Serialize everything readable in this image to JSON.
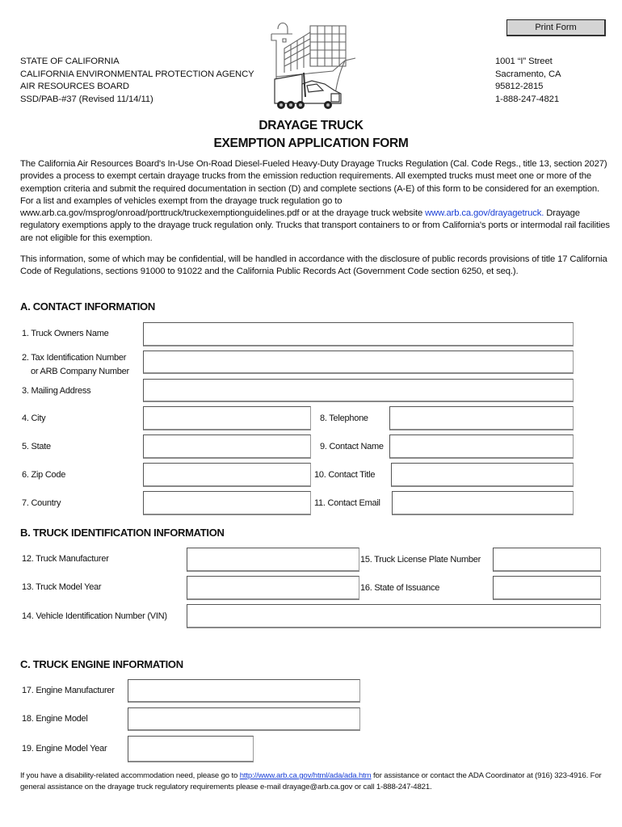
{
  "toolbar": {
    "print_label": "Print Form"
  },
  "header": {
    "left_lines": [
      "STATE OF CALIFORNIA",
      "CALIFORNIA ENVIRONMENTAL PROTECTION AGENCY",
      "AIR RESOURCES BOARD",
      "SSD/PAB-#37 (Revised 11/14/11)"
    ],
    "right_lines": [
      "1001 “I” Street",
      "Sacramento, CA",
      "95812-2815",
      "1-888-247-4821"
    ],
    "logo": "truck-and-ship-logo"
  },
  "title": {
    "line1": "DRAYAGE TRUCK",
    "line2": "EXEMPTION APPLICATION FORM"
  },
  "intro": {
    "para1_part1": "The California Air Resources Board's In-Use On-Road Diesel-Fueled Heavy-Duty Drayage Trucks Regulation (Cal. Code Regs., title 13, section 2027) provides a process to exempt certain drayage trucks from the emission reduction requirements.  All exempted trucks must meet one or more of the exemption criteria and submit the required documentation in section (D) and complete sections (A-E) of this form to be considered for an exemption.  For a list and examples of vehicles exempt from the drayage truck regulation go to www.arb.ca.gov/msprog/onroad/porttruck/truckexemptionguidelines.pdf or at the drayage truck website ",
    "para1_link": "www.arb.ca.gov/drayagetruck.",
    "para1_part2": " Drayage regulatory exemptions apply to the drayage truck regulation only.  Trucks that transport containers to or from California's ports or intermodal rail facilities are not eligible for this exemption.",
    "para2": "This information, some of which may be confidential, will be handled in accordance with the disclosure of public records provisions of title 17 California Code of Regulations, sections 91000 to 91022 and the California Public Records Act (Government Code section 6250, et seq.)."
  },
  "sections": {
    "a": {
      "title": "A.  CONTACT INFORMATION",
      "fields": {
        "f1": {
          "label": "1. Truck Owners Name",
          "value": ""
        },
        "f2": {
          "label": "2. Tax Identification Number",
          "label2": "or ARB Company Number",
          "value": ""
        },
        "f3": {
          "label": "3. Mailing Address",
          "value": ""
        },
        "f4": {
          "label": "4. City",
          "value": ""
        },
        "f5": {
          "label": "5. State",
          "value": ""
        },
        "f6": {
          "label": "6. Zip Code",
          "value": ""
        },
        "f7": {
          "label": "7. Country",
          "value": ""
        },
        "f8": {
          "label": "8. Telephone",
          "value": ""
        },
        "f9": {
          "label": "9. Contact Name",
          "value": ""
        },
        "f10": {
          "label": "10. Contact Title",
          "value": ""
        },
        "f11": {
          "label": "11. Contact Email",
          "value": ""
        }
      }
    },
    "b": {
      "title": "B.  TRUCK IDENTIFICATION INFORMATION",
      "fields": {
        "f12": {
          "label": "12. Truck Manufacturer",
          "value": ""
        },
        "f13": {
          "label": "13. Truck Model Year",
          "value": ""
        },
        "f14": {
          "label": "14. Vehicle Identification Number (VIN)",
          "value": ""
        },
        "f15": {
          "label": "15. Truck License Plate Number",
          "value": ""
        },
        "f16": {
          "label": "16. State of Issuance",
          "value": ""
        }
      }
    },
    "c": {
      "title": "C.  TRUCK ENGINE INFORMATION",
      "fields": {
        "f17": {
          "label": "17. Engine Manufacturer",
          "value": ""
        },
        "f18": {
          "label": "18. Engine Model",
          "value": ""
        },
        "f19": {
          "label": "19. Engine Model Year",
          "value": ""
        }
      }
    }
  },
  "footer": {
    "part1": "If you have a disability-related accommodation need, please go to ",
    "link": "http://www.arb.ca.gov/html/ada/ada.htm",
    "part2": " for assistance or contact the ADA Coordinator at (916) 323-4916.  For general assistance on the drayage truck regulatory requirements please e-mail drayage@arb.ca.gov or call 1-888-247-4821."
  },
  "colors": {
    "link": "#1a3fd6",
    "button_bg": "#d4d4d4"
  }
}
